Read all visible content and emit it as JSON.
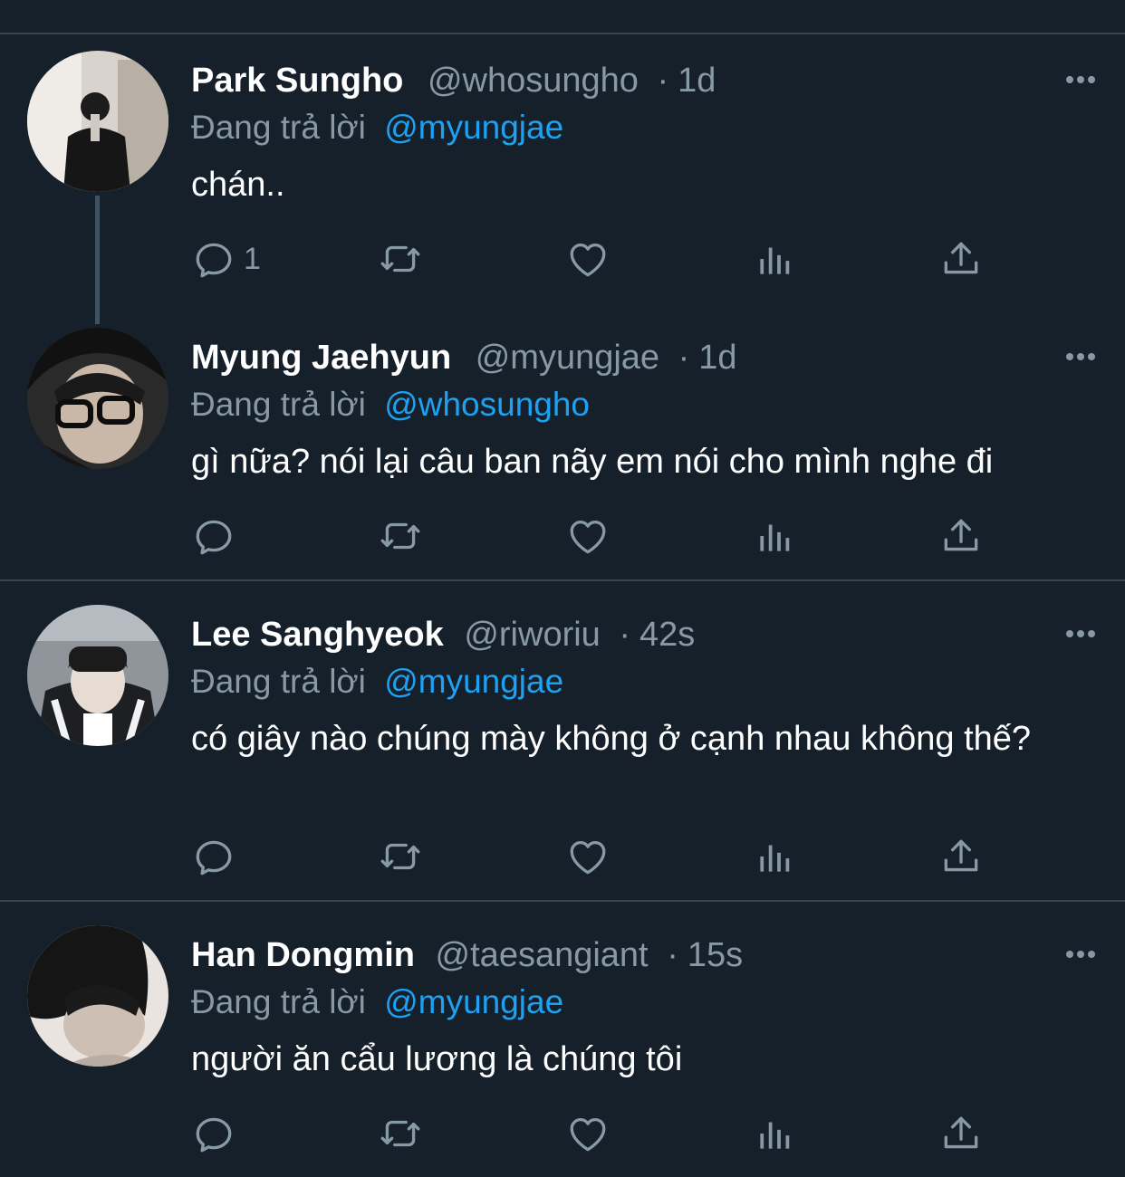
{
  "colors": {
    "background": "#15202b",
    "divider": "#38444d",
    "secondary_text": "#8899a6",
    "accent": "#1da1f2"
  },
  "icons": {
    "more": "more-horizontal-icon",
    "reply": "reply-bubble-icon",
    "retweet": "retweet-icon",
    "like": "heart-icon",
    "analytics": "analytics-bars-icon",
    "share": "share-upload-icon"
  },
  "tweets": [
    {
      "name": "Park Sungho",
      "handle": "@whosungho",
      "separator": "·",
      "time": "1d",
      "reply_prefix": "Đang trả lời",
      "reply_to": "@myungjae",
      "text": "chán..",
      "reply_count": "1"
    },
    {
      "name": "Myung Jaehyun",
      "handle": "@myungjae",
      "separator": "·",
      "time": "1d",
      "reply_prefix": "Đang trả lời",
      "reply_to": "@whosungho",
      "text": "gì nữa? nói lại câu ban nãy em nói cho mình nghe đi",
      "reply_count": ""
    },
    {
      "name": "Lee Sanghyeok",
      "handle": "@riworiu",
      "separator": "·",
      "time": "42s",
      "reply_prefix": "Đang trả lời",
      "reply_to": "@myungjae",
      "text": "có giây nào chúng mày không ở cạnh nhau không thế?",
      "reply_count": ""
    },
    {
      "name": "Han Dongmin",
      "handle": "@taesangiant",
      "separator": "·",
      "time": "15s",
      "reply_prefix": "Đang trả lời",
      "reply_to": "@myungjae",
      "text": "người ăn cẩu lương là chúng tôi",
      "reply_count": ""
    }
  ]
}
